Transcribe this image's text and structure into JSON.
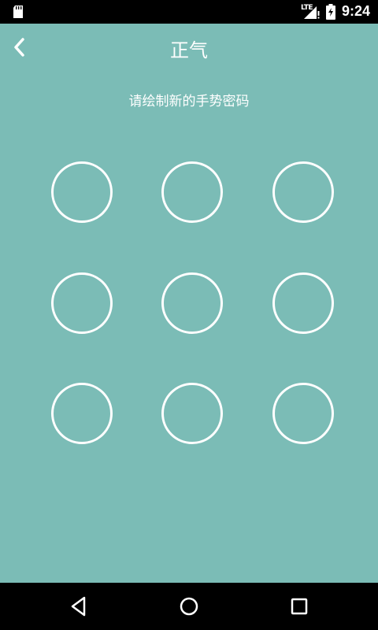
{
  "status_bar": {
    "network": "LTE",
    "time": "9:24",
    "icons": [
      "sd-card-icon",
      "signal-icon",
      "battery-charging-icon"
    ]
  },
  "app_bar": {
    "title": "正气",
    "back_icon": "chevron-left-icon"
  },
  "prompt": "请绘制新的手势密码",
  "pattern_grid": {
    "rows": 3,
    "cols": 3,
    "dot_color": "#ffffff"
  },
  "nav_bar": {
    "icons": [
      "back-triangle-icon",
      "home-circle-icon",
      "recents-square-icon"
    ]
  },
  "colors": {
    "background": "#7bbcb6",
    "bars": "#000000",
    "foreground": "#ffffff"
  }
}
